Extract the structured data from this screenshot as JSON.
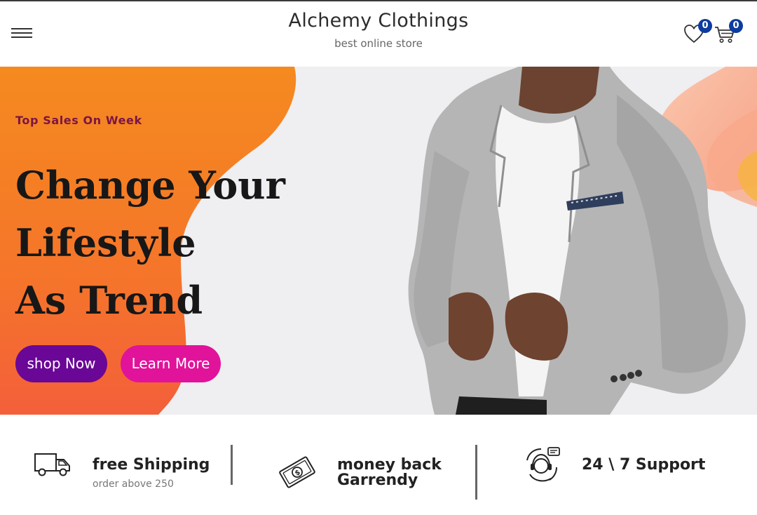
{
  "header": {
    "title": "Alchemy Clothings",
    "subtitle": "best online store",
    "menu_icon": "hamburger-menu-icon",
    "wishlist": {
      "icon": "heart-icon",
      "count": "0"
    },
    "cart": {
      "icon": "shopping-cart-icon",
      "count": "0"
    }
  },
  "hero": {
    "tagline": "Top Sales On Week",
    "headline": [
      "Change Your",
      "Lifestyle",
      "As Trend"
    ],
    "buttons": {
      "shop_label": "shop Now",
      "learn_label": "Learn More"
    },
    "image": "man-in-grey-blazer-photo"
  },
  "features": [
    {
      "icon": "delivery-truck-icon",
      "title": "free Shipping",
      "subtitle": "order above 250"
    },
    {
      "icon": "money-bill-icon",
      "title_lines": [
        "money back",
        "Garrendy"
      ]
    },
    {
      "icon": "customer-support-icon",
      "title": "24 \\ 7 Support"
    }
  ],
  "colors": {
    "brand_badge": "#0d3c9e",
    "tagline": "#7a1544",
    "shop_button": "#6a0796",
    "learn_button": "#e0139a",
    "hero_blob_top": "#f58a1f",
    "hero_blob_bottom": "#f35f3a"
  }
}
